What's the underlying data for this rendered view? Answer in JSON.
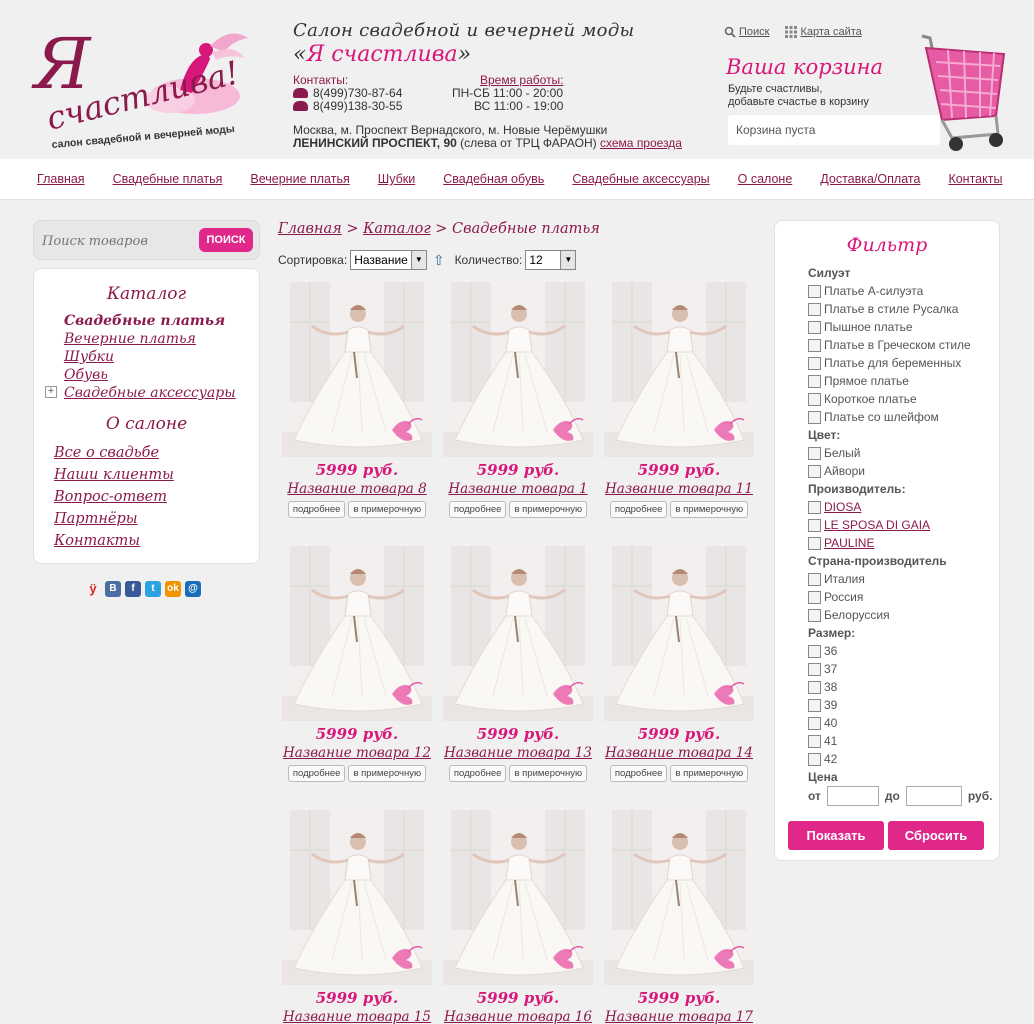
{
  "header": {
    "logo_text": "Я счастлива!",
    "logo_tagline": "салон свадебной и вечерней моды",
    "salon_title": "Салон свадебной и вечерней моды",
    "salon_name_open": "«",
    "salon_name": "Я счастлива",
    "salon_name_close": "»",
    "contacts_label": "Контакты:",
    "phones": [
      "8(499)730-87-64",
      "8(499)138-30-55"
    ],
    "hours_label": "Время работы:",
    "hours": [
      "ПН-СБ 11:00 - 20:00",
      "ВС 11:00 - 19:00"
    ],
    "address_line1": "Москва, м. Проспект Вернадского, м. Новые Черёмушки",
    "address_bold": "ЛЕНИНСКИЙ ПРОСПЕКТ, 90",
    "address_rest": " (слева от ТРЦ ФАРАОН) ",
    "address_link": "схема проезда",
    "search_link": "Поиск",
    "sitemap_link": "Карта сайта",
    "cart_title": "Ваша корзина",
    "cart_sub1": "Будьте счастливы,",
    "cart_sub2": "добавьте счастье в корзину",
    "cart_status": "Корзина пуста"
  },
  "nav": [
    "Главная",
    "Свадебные платья",
    "Вечерние платья",
    "Шубки",
    "Свадебная обувь",
    "Свадебные аксессуары",
    "О салоне",
    "Доставка/Оплата",
    "Контакты"
  ],
  "search": {
    "placeholder": "Поиск товаров",
    "button": "ПОИСК"
  },
  "catalog": {
    "title": "Каталог",
    "items": [
      "Свадебные платья",
      "Вечерние платья",
      "Шубки",
      "Обувь",
      "Свадебные аксессуары"
    ]
  },
  "about": {
    "title": "О салоне",
    "items": [
      "Все о свадьбе",
      "Наши клиенты",
      "Вопрос-ответ",
      "Партнёры",
      "Контакты"
    ]
  },
  "social_icons": [
    "yandex-icon",
    "vk-icon",
    "facebook-icon",
    "twitter-icon",
    "odnoklassniki-icon",
    "mailru-icon"
  ],
  "breadcrumb": {
    "home": "Главная",
    "sep": " > ",
    "catalog": "Каталог",
    "current": "Свадебные платья"
  },
  "sort": {
    "label": "Сортировка:",
    "value": "Название",
    "count_label": "Количество:",
    "count_value": "12"
  },
  "product_buttons": {
    "details": "подробнее",
    "fitting": "в примерочную"
  },
  "products": [
    {
      "price": "5999 руб.",
      "name": "Название товара 8"
    },
    {
      "price": "5999 руб.",
      "name": "Название товара 1"
    },
    {
      "price": "5999 руб.",
      "name": "Название товара 11"
    },
    {
      "price": "5999 руб.",
      "name": "Название товара 12"
    },
    {
      "price": "5999 руб.",
      "name": "Название товара 13"
    },
    {
      "price": "5999 руб.",
      "name": "Название товара 14"
    },
    {
      "price": "5999 руб.",
      "name": "Название товара 15"
    },
    {
      "price": "5999 руб.",
      "name": "Название товара 16"
    },
    {
      "price": "5999 руб.",
      "name": "Название товара 17"
    }
  ],
  "filter": {
    "title": "Фильтр",
    "silhouette_label": "Силуэт",
    "silhouettes": [
      "Платье А-силуэта",
      "Платье в стиле Русалка",
      "Пышное платье",
      "Платье в Греческом стиле",
      "Платье для беременных",
      "Прямое платье",
      "Короткое платье",
      "Платье со шлейфом"
    ],
    "color_label": "Цвет:",
    "colors": [
      "Белый",
      "Айвори"
    ],
    "maker_label": "Производитель:",
    "makers": [
      "DIOSA",
      "LE SPOSA DI GAIA",
      "PAULINE"
    ],
    "country_label": "Страна-производитель",
    "countries": [
      "Италия",
      "Россия",
      "Белоруссия"
    ],
    "size_label": "Размер:",
    "sizes": [
      "36",
      "37",
      "38",
      "39",
      "40",
      "41",
      "42"
    ],
    "price_label": "Цена",
    "from": "от",
    "to": "до",
    "currency": "руб.",
    "show_button": "Показать",
    "reset_button": "Сбросить"
  },
  "colors": {
    "accent": "#d8177a",
    "plum": "#8b1a4c",
    "background": "#f1f0f0"
  }
}
